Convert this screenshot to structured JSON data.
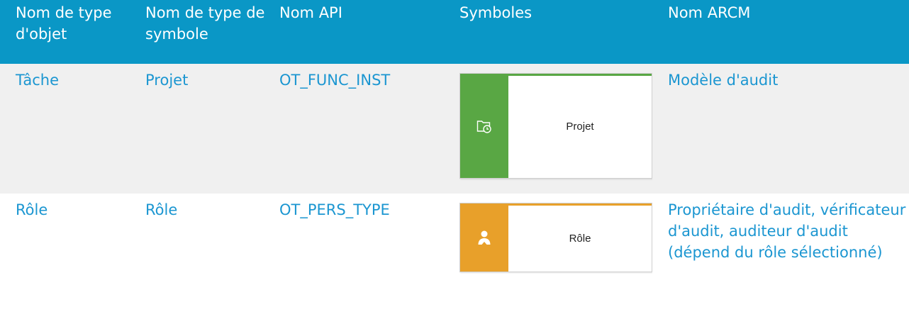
{
  "table": {
    "headers": [
      "Nom de type d'objet",
      "Nom de type de symbole",
      "Nom API",
      "Symboles",
      "Nom ARCM"
    ],
    "rows": [
      {
        "object_type": "Tâche",
        "symbol_type": "Projet",
        "api_name": "OT_FUNC_INST",
        "symbol_label": "Projet",
        "symbol_icon": "folder-clock-icon",
        "symbol_color": "#59a744",
        "arcm_name": "Modèle d'audit"
      },
      {
        "object_type": "Rôle",
        "symbol_type": "Rôle",
        "api_name": "OT_PERS_TYPE",
        "symbol_label": "Rôle",
        "symbol_icon": "person-icon",
        "symbol_color": "#e8a02a",
        "arcm_name": "Propriétaire d'audit, vérificateur d'audit, auditeur d'audit (dépend du rôle sélectionné)"
      }
    ]
  },
  "colors": {
    "header_bg": "#0a97c6",
    "header_text": "#ffffff",
    "link_text": "#1b96d1",
    "row_alt_bg": "#f0f0f0"
  }
}
